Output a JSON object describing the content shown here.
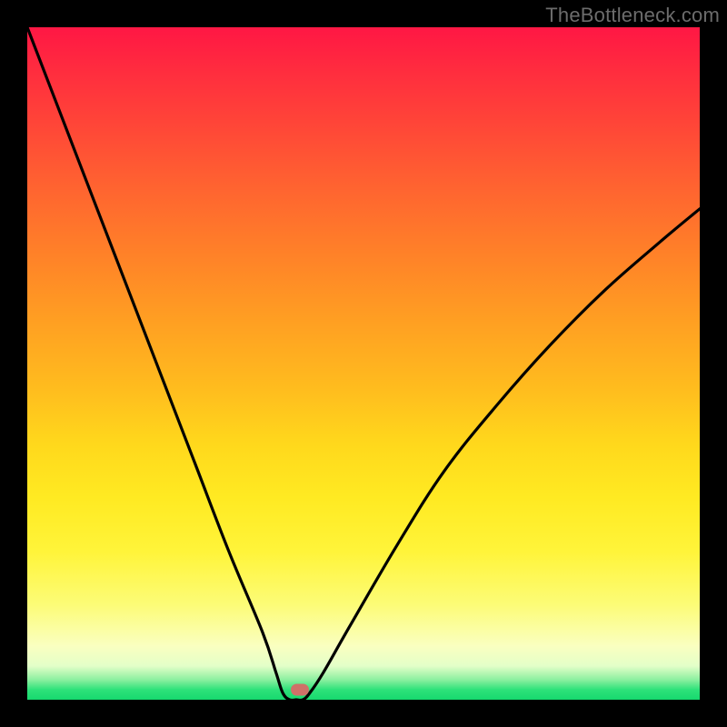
{
  "watermark": "TheBottleneck.com",
  "chart_data": {
    "type": "line",
    "title": "",
    "xlabel": "",
    "ylabel": "",
    "xlim": [
      0,
      100
    ],
    "ylim": [
      0,
      100
    ],
    "series": [
      {
        "name": "bottleneck-curve",
        "x": [
          0,
          5,
          10,
          15,
          20,
          25,
          30,
          35,
          37,
          38,
          39,
          40,
          41,
          42,
          44,
          48,
          55,
          62,
          70,
          78,
          86,
          94,
          100
        ],
        "values": [
          100,
          87,
          74,
          61,
          48,
          35,
          22,
          10,
          4,
          1,
          0,
          0,
          0,
          1,
          4,
          11,
          23,
          34,
          44,
          53,
          61,
          68,
          73
        ]
      }
    ],
    "annotations": [
      {
        "name": "optimal-marker",
        "x": 40.5,
        "y": 1.5
      }
    ],
    "background_gradient": {
      "top": "#ff1744",
      "mid": "#ffd81c",
      "bottom": "#16d96e"
    }
  }
}
